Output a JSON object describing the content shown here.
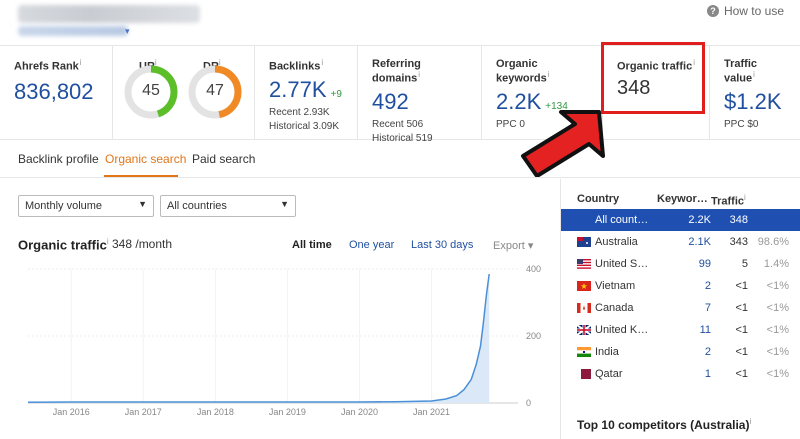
{
  "header": {
    "help_label": "How to use"
  },
  "metrics": {
    "ahrefs_rank": {
      "label": "Ahrefs Rank",
      "value": "836,802"
    },
    "ur": {
      "label": "UR",
      "value": "45",
      "level": 0.45,
      "color": "#5cbf2a"
    },
    "dr": {
      "label": "DR",
      "value": "47",
      "level": 0.47,
      "color": "#f08a24"
    },
    "backlinks": {
      "label": "Backlinks",
      "value": "2.77K",
      "delta": "+9",
      "recent": "Recent 2.93K",
      "historical": "Historical 3.09K"
    },
    "referring_domains": {
      "label": "Referring domains",
      "value": "492",
      "recent": "Recent 506",
      "historical": "Historical 519"
    },
    "organic_keywords": {
      "label": "Organic keywords",
      "value": "2.2K",
      "delta": "+134",
      "sub": "PPC 0"
    },
    "organic_traffic": {
      "label": "Organic traffic",
      "value": "348"
    },
    "traffic_value": {
      "label": "Traffic value",
      "value": "$1.2K",
      "sub": "PPC $0"
    },
    "info_mark": "i"
  },
  "tabs": [
    {
      "label": "Backlink profile"
    },
    {
      "label": "Organic search",
      "active": true
    },
    {
      "label": "Paid search"
    }
  ],
  "filters": {
    "volume": "Monthly volume",
    "country": "All countries"
  },
  "traffic_panel": {
    "title": "Organic traffic",
    "value": "348 /month",
    "ranges": [
      "All time",
      "One year",
      "Last 30 days"
    ],
    "active_range": "All time",
    "export_label": "Export"
  },
  "chart_data": {
    "type": "area",
    "x_ticks": [
      "Jan 2016",
      "Jan 2017",
      "Jan 2018",
      "Jan 2019",
      "Jan 2020",
      "Jan 2021"
    ],
    "y_ticks": [
      "400",
      "200",
      "0"
    ],
    "ylim": [
      0,
      400
    ],
    "series": [
      {
        "color": "#4a90d9",
        "x": [
          2015.4,
          2016.0,
          2017.0,
          2018.0,
          2019.0,
          2020.0,
          2020.5,
          2021.0,
          2021.2,
          2021.35,
          2021.45,
          2021.55,
          2021.62,
          2021.68,
          2021.72,
          2021.76,
          2021.8
        ],
        "y": [
          2,
          3,
          3,
          3,
          3,
          3,
          4,
          6,
          12,
          22,
          40,
          70,
          115,
          170,
          240,
          320,
          385
        ]
      }
    ]
  },
  "countries": {
    "headers": {
      "country": "Country",
      "keywords": "Keywor…",
      "traffic": "Traffic"
    },
    "rows": [
      {
        "name": "All count…",
        "keywords": "2.2K",
        "traffic": "348",
        "pct": "",
        "flag": "none",
        "selected": true
      },
      {
        "name": "Australia",
        "keywords": "2.1K",
        "traffic": "343",
        "pct": "98.6%",
        "flag": "au"
      },
      {
        "name": "United S…",
        "keywords": "99",
        "traffic": "5",
        "pct": "1.4%",
        "flag": "us"
      },
      {
        "name": "Vietnam",
        "keywords": "2",
        "traffic": "<1",
        "pct": "<1%",
        "flag": "vn"
      },
      {
        "name": "Canada",
        "keywords": "7",
        "traffic": "<1",
        "pct": "<1%",
        "flag": "ca"
      },
      {
        "name": "United K…",
        "keywords": "11",
        "traffic": "<1",
        "pct": "<1%",
        "flag": "uk"
      },
      {
        "name": "India",
        "keywords": "2",
        "traffic": "<1",
        "pct": "<1%",
        "flag": "in"
      },
      {
        "name": "Qatar",
        "keywords": "1",
        "traffic": "<1",
        "pct": "<1%",
        "flag": "qa"
      }
    ]
  },
  "competitors_title": "Top 10 competitors (Australia)"
}
